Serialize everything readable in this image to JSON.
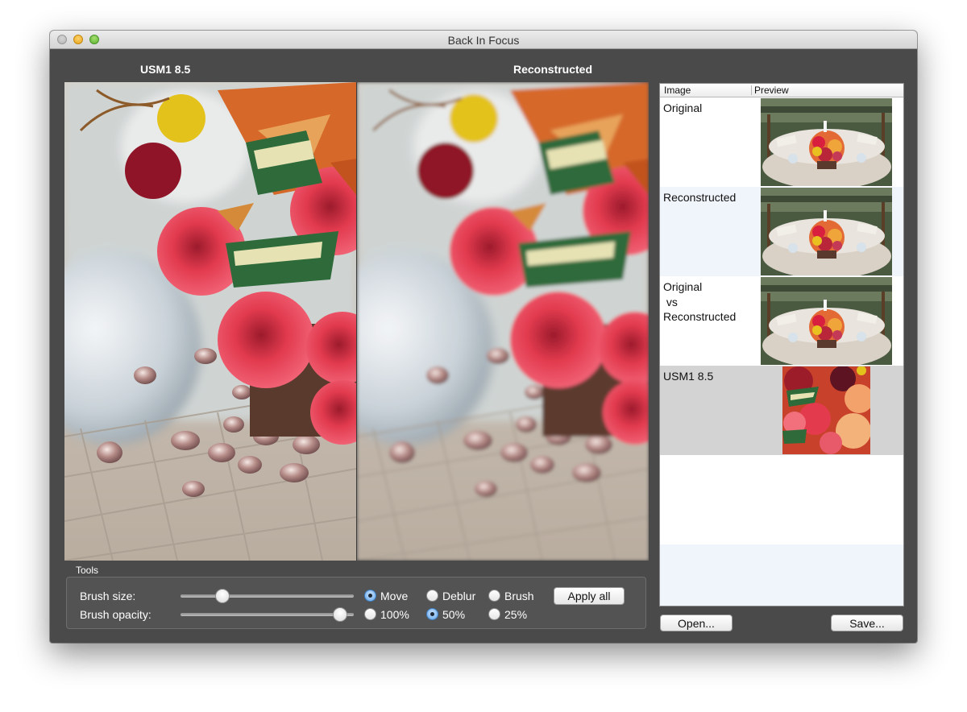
{
  "window": {
    "title": "Back In Focus"
  },
  "panes": {
    "left_label": "USM1 8.5",
    "right_label": "Reconstructed"
  },
  "tools": {
    "group_label": "Tools",
    "brush_size_label": "Brush size:",
    "brush_opacity_label": "Brush opacity:",
    "brush_size_value": 0.22,
    "brush_opacity_value": 0.96,
    "mode_options": [
      "Move",
      "Deblur",
      "Brush"
    ],
    "mode_selected": "Move",
    "opacity_options": [
      "100%",
      "50%",
      "25%"
    ],
    "opacity_selected": "50%",
    "apply_all": "Apply all"
  },
  "table": {
    "columns": [
      "Image",
      "Preview"
    ],
    "rows": [
      {
        "label": "Original"
      },
      {
        "label": "Reconstructed"
      },
      {
        "label": "Original\n vs\nReconstructed"
      },
      {
        "label": "USM1 8.5"
      }
    ]
  },
  "buttons": {
    "open": "Open...",
    "save": "Save..."
  },
  "icons": {
    "close": "window-close-icon",
    "minimize": "window-minimize-icon",
    "maximize": "window-zoom-icon"
  }
}
